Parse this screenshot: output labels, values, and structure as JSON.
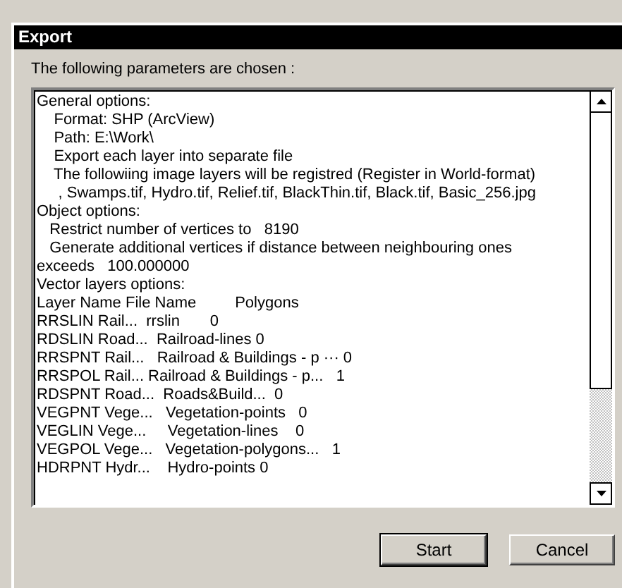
{
  "window": {
    "title": "Export"
  },
  "prompt": "The following parameters are chosen :",
  "lines": [
    "General options:",
    "    Format: SHP (ArcView)",
    "    Path: E:\\Work\\",
    "    Export each layer into separate file",
    "    The followiing image layers will be registred (Register in World-format)",
    "     , Swamps.tif, Hydro.tif, Relief.tif, BlackThin.tif, Black.tif, Basic_256.jpg",
    "Object options:",
    "   Restrict number of vertices to   8190",
    "   Generate additional vertices if distance between neighbouring ones",
    "exceeds   100.000000",
    "Vector layers options:",
    "Layer Name File Name         Polygons",
    "RRSLIN Rail...  rrslin       0",
    "RDSLIN Road...  Railroad-lines 0",
    "RRSPNT Rail...   Railroad & Buildings - p ··· 0",
    "RRSPOL Rail... Railroad & Buildings - p...   1",
    "RDSPNT Road...  Roads&Build...  0",
    "VEGPNT Vege...   Vegetation-points   0",
    "VEGLIN Vege...     Vegetation-lines    0",
    "VEGPOL Vege...   Vegetation-polygons...   1",
    "HDRPNT Hydr...    Hydro-points 0"
  ],
  "buttons": [
    {
      "label": "Start",
      "default": true
    },
    {
      "label": "Cancel",
      "default": false
    }
  ]
}
